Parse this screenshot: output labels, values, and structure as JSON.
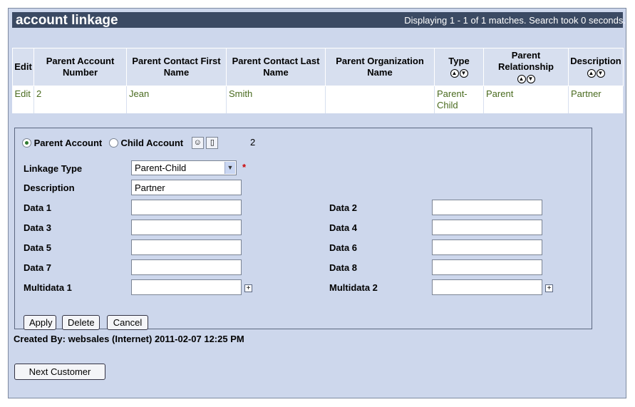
{
  "header": {
    "title": "account linkage",
    "matches": "Displaying 1 - 1 of 1 matches. Search took 0 seconds."
  },
  "table": {
    "columns": [
      {
        "label": "Edit",
        "sortable": false
      },
      {
        "label": "Parent Account Number",
        "sortable": false
      },
      {
        "label": "Parent Contact First Name",
        "sortable": false
      },
      {
        "label": "Parent Contact Last Name",
        "sortable": false
      },
      {
        "label": "Parent Organization Name",
        "sortable": false
      },
      {
        "label": "Type",
        "sortable": true
      },
      {
        "label": "Parent Relationship",
        "sortable": true
      },
      {
        "label": "Description",
        "sortable": true
      }
    ],
    "rows": [
      [
        "Edit",
        "2",
        "Jean",
        "Smith",
        "",
        "Parent-Child",
        "Parent",
        "Partner"
      ]
    ]
  },
  "form": {
    "radio_parent": "Parent Account",
    "radio_child": "Child Account",
    "account_number": "2",
    "linkage_type_label": "Linkage Type",
    "linkage_type_value": "Parent-Child",
    "required_mark": "*",
    "description_label": "Description",
    "description_value": "Partner",
    "fields_left": [
      {
        "label": "Data 1",
        "value": ""
      },
      {
        "label": "Data 3",
        "value": ""
      },
      {
        "label": "Data 5",
        "value": ""
      },
      {
        "label": "Data 7",
        "value": ""
      },
      {
        "label": "Multidata 1",
        "value": ""
      }
    ],
    "fields_right": [
      {
        "label": "Data 2",
        "value": ""
      },
      {
        "label": "Data 4",
        "value": ""
      },
      {
        "label": "Data 6",
        "value": ""
      },
      {
        "label": "Data 8",
        "value": ""
      },
      {
        "label": "Multidata 2",
        "value": ""
      }
    ],
    "buttons": {
      "apply": "Apply",
      "delete": "Delete",
      "cancel": "Cancel"
    }
  },
  "footer": {
    "created_by": "Created By: websales (Internet) 2011-02-07 12:25 PM",
    "next_customer": "Next Customer"
  },
  "icons": {
    "sort_up": "sort-ascending-icon",
    "sort_down": "sort-descending-icon",
    "contact": "contact-lookup-icon",
    "clear": "clear-icon",
    "plus": "add-icon"
  }
}
